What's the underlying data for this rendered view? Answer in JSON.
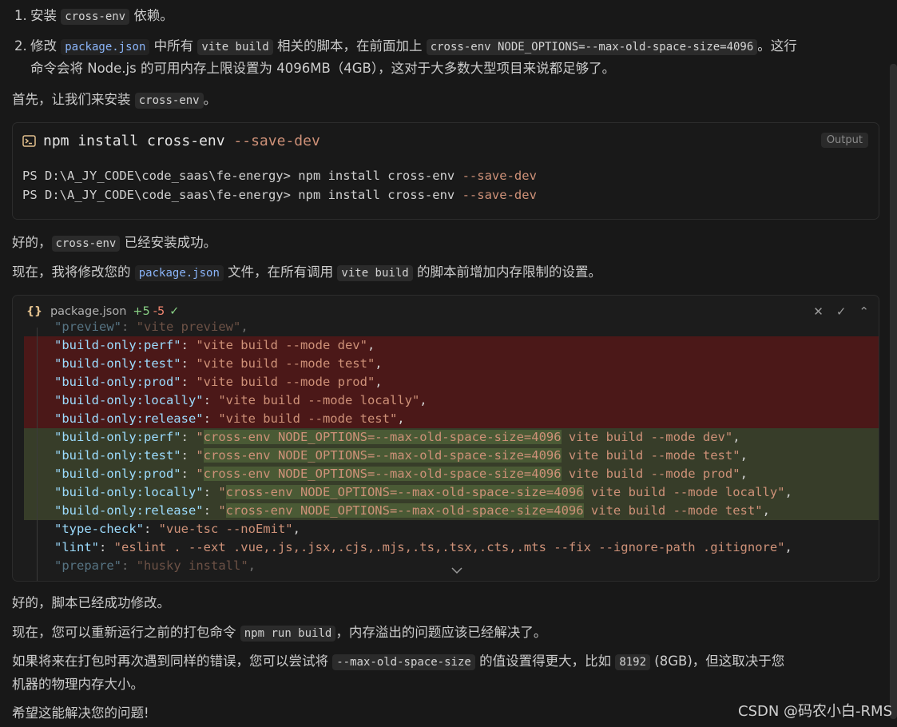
{
  "steps": [
    {
      "num": "1.",
      "pre": "安装 ",
      "code": "cross-env",
      "post": " 依赖。"
    },
    {
      "num": "2.",
      "pre": "修改 ",
      "code1": "package.json",
      "mid1": " 中所有 ",
      "code2": "vite build",
      "mid2": " 相关的脚本，在前面加上 ",
      "code3": "cross-env NODE_OPTIONS=--max-old-space-size=4096",
      "post": "。这行",
      "line2": "命令会将 Node.js 的可用内存上限设置为 4096MB（4GB），这对于大多数大型项目来说都足够了。"
    }
  ],
  "para1": {
    "pre": "首先，让我们来安装 ",
    "code": "cross-env",
    "post": "。"
  },
  "terminal": {
    "cmd_plain": "npm install cross-env ",
    "cmd_flag": "--save-dev",
    "badge": "Output",
    "lines": [
      {
        "plain": "PS D:\\A_JY_CODE\\code_saas\\fe-energy> npm install cross-env ",
        "flag": "--save-dev"
      },
      {
        "plain": "PS D:\\A_JY_CODE\\code_saas\\fe-energy> npm install cross-env ",
        "flag": "--save-dev"
      }
    ]
  },
  "para2": {
    "pre": "好的，",
    "code": "cross-env",
    "post": " 已经安装成功。"
  },
  "para3": {
    "pre": "现在，我将修改您的 ",
    "code1": "package.json",
    "mid": " 文件，在所有调用 ",
    "code2": "vite build",
    "post": " 的脚本前增加内存限制的设置。"
  },
  "diff": {
    "file": "package.json",
    "added": "+5",
    "removed": "-5",
    "top_line": {
      "k": "\"preview\"",
      "s": "\"vite preview\""
    },
    "removed_lines": [
      {
        "k": "\"build-only:perf\"",
        "s": "\"vite build --mode dev\""
      },
      {
        "k": "\"build-only:test\"",
        "s": "\"vite build --mode test\""
      },
      {
        "k": "\"build-only:prod\"",
        "s": "\"vite build --mode prod\""
      },
      {
        "k": "\"build-only:locally\"",
        "s": "\"vite build --mode locally\""
      },
      {
        "k": "\"build-only:release\"",
        "s": "\"vite build --mode test\""
      }
    ],
    "added_prefix": "cross-env NODE_OPTIONS=--max-old-space-size=4096",
    "added_lines": [
      {
        "k": "\"build-only:perf\"",
        "rest": " vite build --mode dev\""
      },
      {
        "k": "\"build-only:test\"",
        "rest": " vite build --mode test\""
      },
      {
        "k": "\"build-only:prod\"",
        "rest": " vite build --mode prod\""
      },
      {
        "k": "\"build-only:locally\"",
        "rest": " vite build --mode locally\""
      },
      {
        "k": "\"build-only:release\"",
        "rest": " vite build --mode test\""
      }
    ],
    "after_lines": [
      {
        "k": "\"type-check\"",
        "s": "\"vue-tsc --noEmit\""
      },
      {
        "k": "\"lint\"",
        "s": "\"eslint . --ext .vue,.js,.jsx,.cjs,.mjs,.ts,.tsx,.cts,.mts --fix --ignore-path .gitignore\""
      },
      {
        "k": "\"prepare\"",
        "s": "\"husky install\""
      }
    ]
  },
  "para4": "好的，脚本已经成功修改。",
  "para5": {
    "pre": "现在，您可以重新运行之前的打包命令 ",
    "code": "npm run build",
    "post": "，内存溢出的问题应该已经解决了。"
  },
  "para6": {
    "pre": "如果将来在打包时再次遇到同样的错误，您可以尝试将 ",
    "code1": "--max-old-space-size",
    "mid": " 的值设置得更大，比如 ",
    "code2": "8192",
    "post": " (8GB)，但这取决于您",
    "line2": "机器的物理内存大小。"
  },
  "para7": "希望这能解决您的问题!",
  "watermark": "CSDN @码农小白-RMS"
}
